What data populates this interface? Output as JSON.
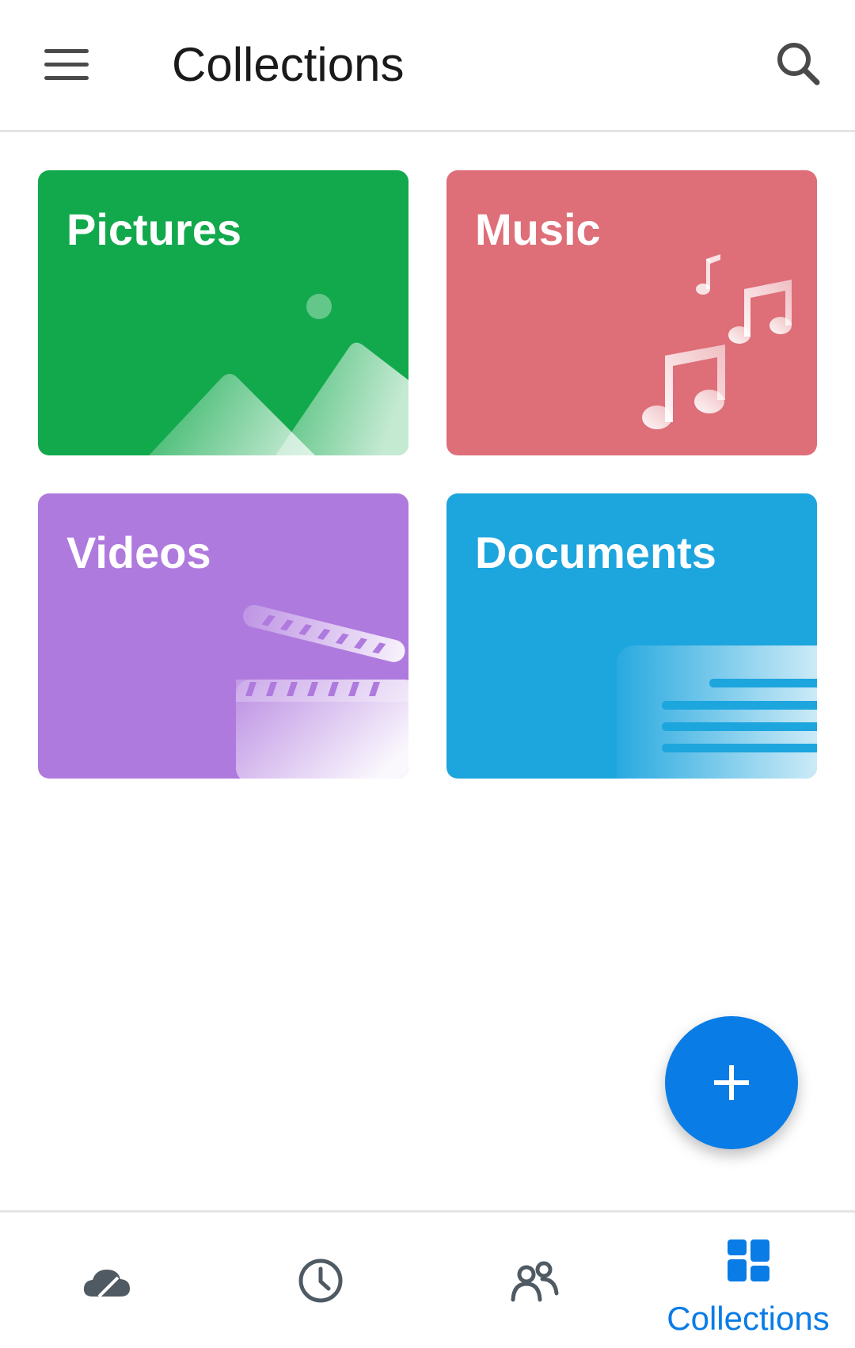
{
  "app_bar": {
    "title": "Collections",
    "menu_icon": "hamburger-menu-icon",
    "search_icon": "search-icon"
  },
  "collections": [
    {
      "label": "Pictures",
      "color": "#12A94C",
      "icon": "landscape-image-icon"
    },
    {
      "label": "Music",
      "color": "#DE6E78",
      "icon": "music-notes-icon"
    },
    {
      "label": "Videos",
      "color": "#AF7ADE",
      "icon": "clapperboard-icon"
    },
    {
      "label": "Documents",
      "color": "#1DA5DE",
      "icon": "document-lines-icon"
    }
  ],
  "fab": {
    "icon": "plus-icon",
    "color": "#0A7CE6"
  },
  "bottom_nav": {
    "items": [
      {
        "icon": "cloud-icon",
        "label": ""
      },
      {
        "icon": "clock-icon",
        "label": ""
      },
      {
        "icon": "people-icon",
        "label": ""
      },
      {
        "icon": "collections-grid-icon",
        "label": "Collections",
        "active": true
      }
    ],
    "active_color": "#0A7CE6",
    "inactive_color": "#4F5A63"
  }
}
